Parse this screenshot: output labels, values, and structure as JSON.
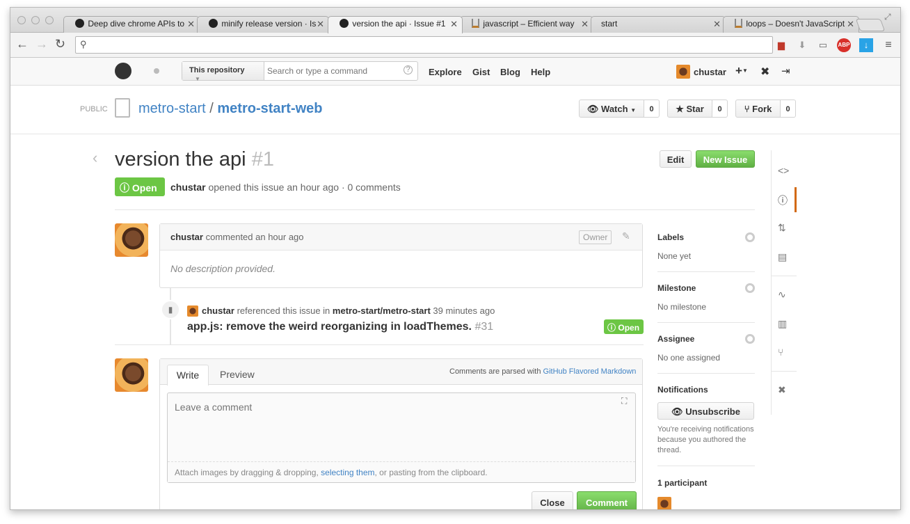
{
  "browser": {
    "tabs": [
      {
        "title": "Deep dive chrome APIs to",
        "icon": "github-icon"
      },
      {
        "title": "minify release version · Is",
        "icon": "github-icon"
      },
      {
        "title": "version the api · Issue #1",
        "icon": "github-icon",
        "active": true
      },
      {
        "title": "javascript – Efficient way",
        "icon": "stackoverflow-icon"
      },
      {
        "title": "start",
        "icon": ""
      },
      {
        "title": "loops – Doesn't JavaScript",
        "icon": "stackoverflow-icon"
      }
    ],
    "omnibox": "",
    "extensions": {
      "abp": "ABP"
    }
  },
  "gh": {
    "scope": "This repository",
    "search_placeholder": "Search or type a command",
    "nav": [
      "Explore",
      "Gist",
      "Blog",
      "Help"
    ],
    "username": "chustar",
    "plus": "+"
  },
  "repo": {
    "visibility": "PUBLIC",
    "owner": "metro-start",
    "slash": "/",
    "name": "metro-start-web",
    "watch": "Watch",
    "watch_count": "0",
    "star": "Star",
    "star_count": "0",
    "fork": "Fork",
    "fork_count": "0"
  },
  "issue": {
    "title": "version the api",
    "number": "#1",
    "state": "Open",
    "author": "chustar",
    "meta": "opened this issue an hour ago · 0 comments",
    "edit": "Edit",
    "new_issue": "New Issue"
  },
  "comment": {
    "author": "chustar",
    "meta": "commented an hour ago",
    "owner_badge": "Owner",
    "body": "No description provided."
  },
  "reference": {
    "author": "chustar",
    "text": "referenced this issue in",
    "repo": "metro-start/metro-start",
    "time": "39 minutes ago",
    "title": "app.js: remove the weird reorganizing in loadThemes.",
    "number": "#31",
    "state": "Open"
  },
  "composer": {
    "tab_write": "Write",
    "tab_preview": "Preview",
    "parsed_text": "Comments are parsed with",
    "parsed_link": "GitHub Flavored Markdown",
    "placeholder": "Leave a comment",
    "attach_pre": "Attach images by dragging & dropping,",
    "attach_link": "selecting them",
    "attach_post": ", or pasting from the clipboard.",
    "close": "Close",
    "submit": "Comment"
  },
  "sidebar": {
    "labels_title": "Labels",
    "labels_value": "None yet",
    "milestone_title": "Milestone",
    "milestone_value": "No milestone",
    "assignee_title": "Assignee",
    "assignee_value": "No one assigned",
    "notifications_title": "Notifications",
    "unsubscribe": "Unsubscribe",
    "notif_l1": "You're receiving notifications",
    "notif_l2": "because you authored the",
    "notif_l3": "thread.",
    "participants": "1 participant"
  },
  "colors": {
    "open_green": "#6cc644",
    "link_blue": "#4183c4",
    "active_orange": "#d26911"
  }
}
